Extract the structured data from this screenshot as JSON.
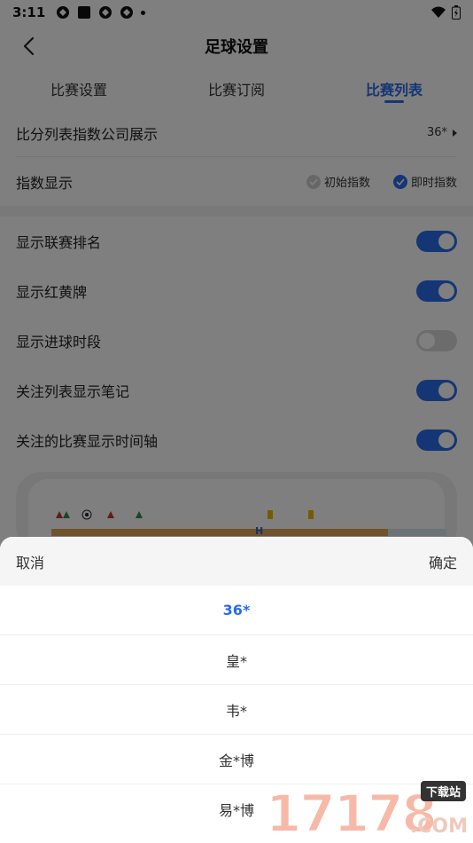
{
  "status_bar": {
    "time": "3:11"
  },
  "header": {
    "title": "足球设置"
  },
  "tabs": [
    {
      "label": "比赛设置",
      "active": false
    },
    {
      "label": "比赛订阅",
      "active": false
    },
    {
      "label": "比赛列表",
      "active": true
    }
  ],
  "settings": {
    "company_display": {
      "label": "比分列表指数公司展示",
      "value": "36*"
    },
    "index_display": {
      "label": "指数显示",
      "options": [
        {
          "label": "初始指数",
          "checked": false
        },
        {
          "label": "即时指数",
          "checked": true
        }
      ]
    },
    "toggles": [
      {
        "label": "显示联赛排名",
        "on": true
      },
      {
        "label": "显示红黄牌",
        "on": true
      },
      {
        "label": "显示进球时段",
        "on": false
      },
      {
        "label": "关注列表显示笔记",
        "on": true
      },
      {
        "label": "关注的比赛显示时间轴",
        "on": true
      }
    ]
  },
  "preview": {
    "half_marker": "H"
  },
  "picker": {
    "cancel_label": "取消",
    "confirm_label": "确定",
    "options": [
      "36*",
      "皇*",
      "韦*",
      "金*博",
      "易*博"
    ],
    "selected": "36*"
  },
  "watermark": {
    "digits": "17178",
    "badge": "下载站",
    "suffix": ".COM"
  },
  "colors": {
    "accent": "#2a6ce8",
    "toggle_off": "#d8d8d8"
  }
}
